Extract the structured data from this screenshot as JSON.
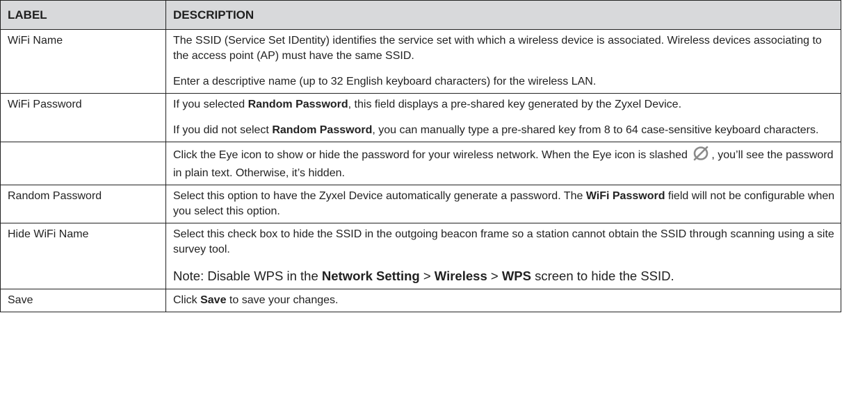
{
  "header": {
    "label": "LABEL",
    "description": "DESCRIPTION"
  },
  "rows": {
    "wifi_name": {
      "label": "WiFi Name",
      "p1": "The SSID (Service Set IDentity) identifies the service set with which a wireless device is associated. Wireless devices associating to the access point (AP) must have the same SSID.",
      "p2": "Enter a descriptive name (up to 32 English keyboard characters) for the wireless LAN."
    },
    "wifi_password": {
      "label": "WiFi Password",
      "p1_pre": "If you selected ",
      "p1_bold": "Random Password",
      "p1_post": ", this field displays a pre-shared key generated by the Zyxel Device.",
      "p2_pre": "If you did not select ",
      "p2_bold": "Random Password",
      "p2_post": ", you can manually type a pre-shared key from 8 to 64 case-sensitive keyboard characters."
    },
    "eye": {
      "label": "",
      "pre": "Click the Eye icon to show or hide the password for your wireless network. When the Eye icon is slashed ",
      "post": ", you’ll see the password in plain text. Otherwise, it’s hidden.",
      "icon": "eye-slashed-icon",
      "icon_color": "#8a8a8a"
    },
    "random_password": {
      "label": "Random Password",
      "pre": "Select this option to have the Zyxel Device automatically generate a password. The ",
      "bold": "WiFi Password",
      "post": " field will not be configurable when you select this option."
    },
    "hide_wifi_name": {
      "label": "Hide WiFi Name",
      "p1": "Select this check box to hide the SSID in the outgoing beacon frame so a station cannot obtain the SSID through scanning using a site survey tool.",
      "note_pre": "Note: Disable WPS in the ",
      "note_b1": "Network Setting",
      "sep1": " > ",
      "note_b2": "Wireless",
      "sep2": " > ",
      "note_b3": "WPS",
      "note_post": " screen to hide the SSID."
    },
    "save": {
      "label": "Save",
      "pre": "Click ",
      "bold": "Save",
      "post": " to save your changes."
    }
  }
}
